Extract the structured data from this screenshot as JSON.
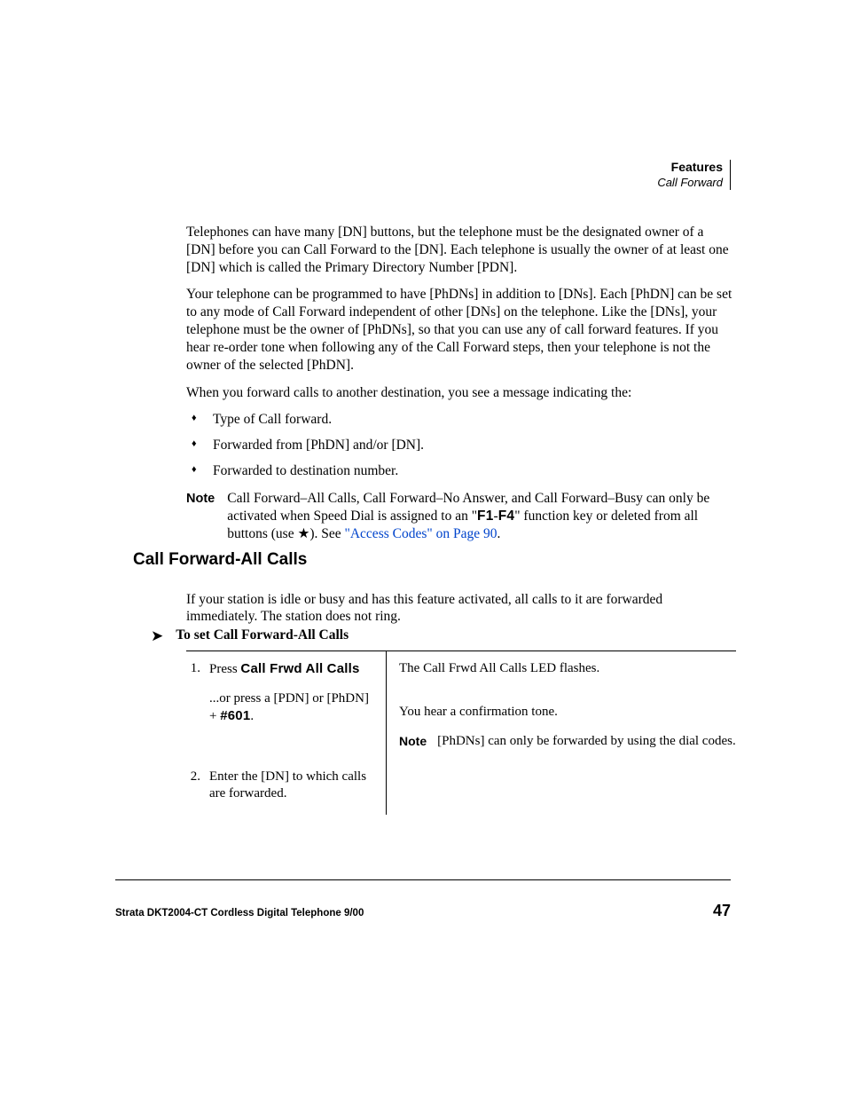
{
  "header": {
    "chapter": "Features",
    "section": "Call Forward"
  },
  "body": {
    "p1": "Telephones can have many [DN] buttons, but the telephone must be the designated owner of a [DN] before you can Call Forward to the [DN]. Each telephone is usually the owner of at least one [DN] which is called the Primary Directory Number [PDN].",
    "p2": "Your telephone can be programmed to have [PhDNs] in addition to [DNs]. Each [PhDN] can be set to any mode of Call Forward independent of other [DNs] on the telephone. Like the [DNs], your telephone must be the owner of [PhDNs], so that you can use any of call forward features. If you hear re-order tone when following any of the Call Forward steps, then your telephone is not the owner of the selected [PhDN].",
    "p3": "When you forward calls to another destination, you see a message indicating the:",
    "bullets": [
      "Type of Call forward.",
      "Forwarded from [PhDN] and/or [DN].",
      "Forwarded to destination number."
    ],
    "note_label": "Note",
    "note_pre": "Call Forward–All Calls, Call Forward–No Answer, and Call Forward–Busy can only be activated when Speed Dial is assigned to an \"",
    "note_f1": "F1",
    "note_dash": "-",
    "note_f4": "F4",
    "note_mid": "\" function key or deleted from all buttons (use ",
    "note_star": "★",
    "note_after_star": "). See ",
    "note_link": "\"Access Codes\" on Page 90",
    "note_end": "."
  },
  "h2": "Call Forward-All Calls",
  "after_h2": "If your station is idle or busy and has this feature activated, all calls to it are forwarded immediately. The station does not ring.",
  "proc": {
    "arrow": "➤",
    "title": "To set Call Forward-All Calls",
    "steps": [
      {
        "num": "1.",
        "text_pre": "Press ",
        "button": "Call Frwd All Calls",
        "sub_pre": "...or press a [PDN] or [PhDN] + ",
        "sub_code": "#601",
        "sub_post": "."
      },
      {
        "num": "2.",
        "text": "Enter the [DN] to which calls are forwarded."
      }
    ],
    "right": {
      "r1": "The Call Frwd All Calls LED flashes.",
      "r2": "You hear a confirmation tone.",
      "note_label": "Note",
      "note_text": "[PhDNs] can only be forwarded by using the dial codes."
    }
  },
  "footer": {
    "text": "Strata DKT2004-CT Cordless Digital Telephone   9/00",
    "page": "47"
  }
}
